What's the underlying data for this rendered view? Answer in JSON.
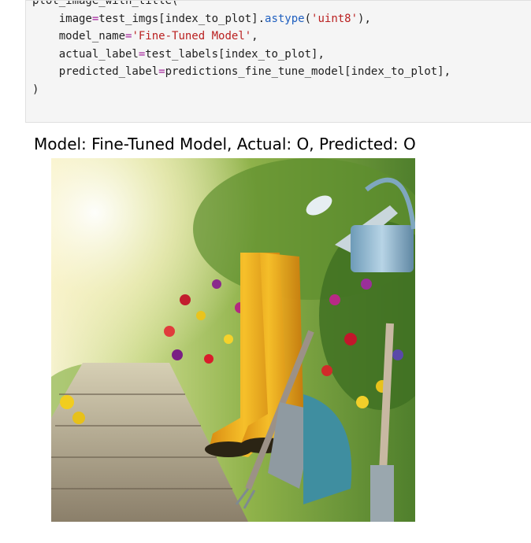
{
  "code_cell": {
    "lines": [
      {
        "tokens": [
          {
            "t": "plot_image_with_title(",
            "c": "tok-var"
          }
        ]
      },
      {
        "tokens": [
          {
            "t": "    image",
            "c": "tok-var"
          },
          {
            "t": "=",
            "c": "tok-op"
          },
          {
            "t": "test_imgs[index_to_plot].",
            "c": "tok-var"
          },
          {
            "t": "astype",
            "c": "tok-attr"
          },
          {
            "t": "(",
            "c": "tok-punct"
          },
          {
            "t": "'uint8'",
            "c": "tok-str"
          },
          {
            "t": "),",
            "c": "tok-punct"
          }
        ]
      },
      {
        "tokens": [
          {
            "t": "    model_name",
            "c": "tok-var"
          },
          {
            "t": "=",
            "c": "tok-op"
          },
          {
            "t": "'Fine-Tuned Model'",
            "c": "tok-str"
          },
          {
            "t": ",",
            "c": "tok-punct"
          }
        ]
      },
      {
        "tokens": [
          {
            "t": "    actual_label",
            "c": "tok-var"
          },
          {
            "t": "=",
            "c": "tok-op"
          },
          {
            "t": "test_labels[index_to_plot],",
            "c": "tok-var"
          }
        ]
      },
      {
        "tokens": [
          {
            "t": "    predicted_label",
            "c": "tok-var"
          },
          {
            "t": "=",
            "c": "tok-op"
          },
          {
            "t": "predictions_fine_tune_model[index_to_plot],",
            "c": "tok-var"
          }
        ]
      },
      {
        "tokens": [
          {
            "t": ")",
            "c": "tok-punct"
          }
        ]
      }
    ]
  },
  "output": {
    "title": "Model: Fine-Tuned Model, Actual: O, Predicted: O"
  }
}
